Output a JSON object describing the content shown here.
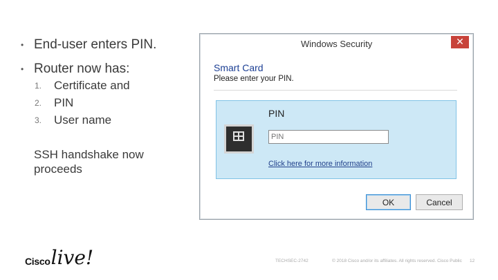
{
  "slide": {
    "bullets": [
      "End-user enters PIN.",
      "Router now has:"
    ],
    "sub_items": [
      {
        "num": "1.",
        "text": "Certificate and"
      },
      {
        "num": "2.",
        "text": "PIN"
      },
      {
        "num": "3.",
        "text": "User name"
      }
    ],
    "paragraph": "SSH handshake now proceeds"
  },
  "dialog": {
    "title": "Windows Security",
    "close_glyph": "✕",
    "heading": "Smart Card",
    "subheading": "Please enter your PIN.",
    "credential_tile": {
      "icon": "smart-card-icon",
      "label": "PIN",
      "input_value": "",
      "input_placeholder": "PIN",
      "link": "Click here for more information"
    },
    "buttons": {
      "ok": "OK",
      "cancel": "Cancel"
    },
    "colors": {
      "close": "#c8433a",
      "tile": "#cde8f6",
      "heading": "#1c3f94"
    }
  },
  "footer": {
    "brand_cisco": "Cisco",
    "brand_live": "live!",
    "session_id": "TECHSEC-2742",
    "copyright": "© 2018 Cisco and/or its affiliates. All rights reserved. Cisco Public",
    "page": "12"
  }
}
